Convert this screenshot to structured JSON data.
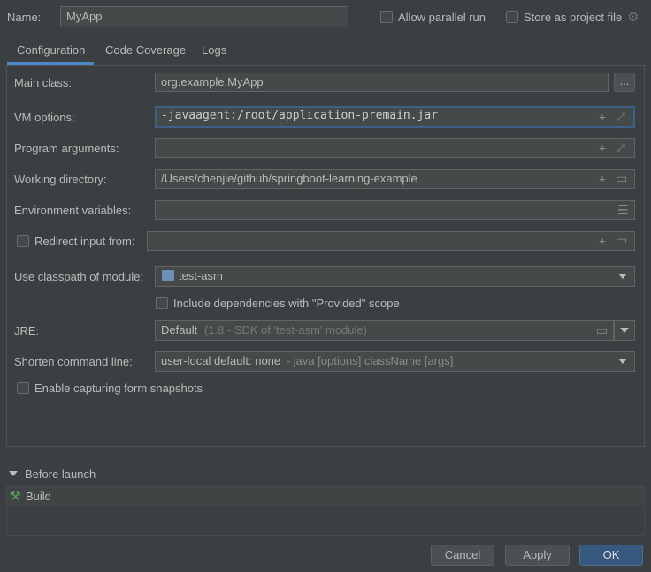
{
  "header": {
    "name_label": "Name:",
    "name_value": "MyApp",
    "allow_parallel_label": "Allow parallel run",
    "store_project_label": "Store as project file"
  },
  "tabs": [
    {
      "label": "Configuration",
      "active": true
    },
    {
      "label": "Code Coverage",
      "active": false
    },
    {
      "label": "Logs",
      "active": false
    }
  ],
  "form": {
    "main_class_label": "Main class:",
    "main_class_value": "org.example.MyApp",
    "browse_label": "...",
    "vm_options_label": "VM options:",
    "vm_options_value": "-javaagent:/root/application-premain.jar",
    "program_args_label": "Program arguments:",
    "program_args_value": "",
    "working_dir_label": "Working directory:",
    "working_dir_value": "/Users/chenjie/github/springboot-learning-example",
    "env_vars_label": "Environment variables:",
    "env_vars_value": "",
    "redirect_input_label": "Redirect input from:",
    "redirect_input_value": "",
    "classpath_label": "Use classpath of module:",
    "classpath_value": "test-asm",
    "include_deps_label": "Include dependencies with \"Provided\" scope",
    "jre_label": "JRE:",
    "jre_value": "Default",
    "jre_hint": "(1.8 - SDK of 'test-asm' module)",
    "shorten_label": "Shorten command line:",
    "shorten_value": "user-local default: none",
    "shorten_hint": "- java [options] className [args]",
    "capture_label": "Enable capturing form snapshots"
  },
  "before_launch": {
    "title": "Before launch",
    "items": [
      {
        "label": "Build"
      }
    ]
  },
  "buttons": {
    "cancel": "Cancel",
    "apply": "Apply",
    "ok": "OK"
  },
  "colors": {
    "background": "#3c3f41",
    "field": "#45494a",
    "accent": "#365880",
    "tab_underline": "#4a88c7",
    "focus_border": "#3d6185"
  }
}
